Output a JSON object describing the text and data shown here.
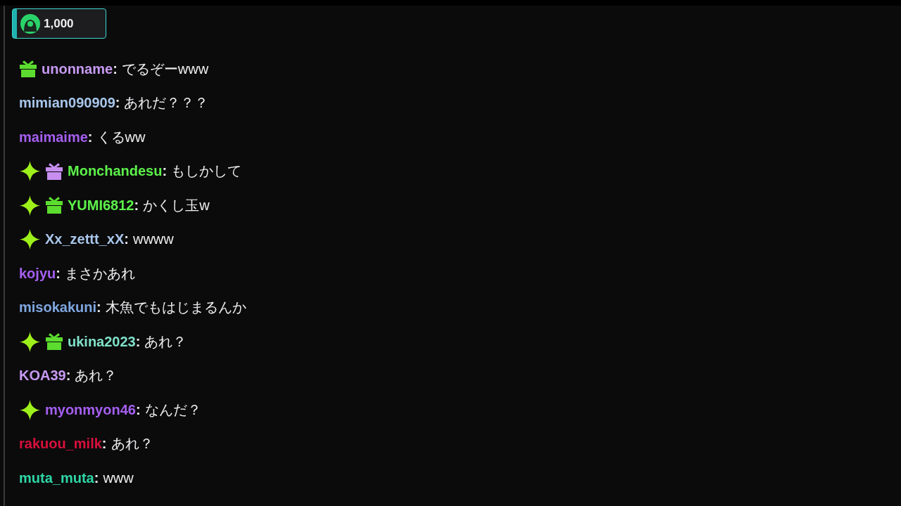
{
  "points_badge": {
    "count": "1,000"
  },
  "messages": [
    {
      "badges": [
        {
          "kind": "gift",
          "color": "#5bdc2e"
        }
      ],
      "user": "unonname",
      "color": "#c79af2",
      "colon": ":",
      "text": "でるぞーwww"
    },
    {
      "user": "mimian090909",
      "color": "#a9c6ea",
      "colon": ":",
      "text": "あれだ？？？"
    },
    {
      "user": "maimaime",
      "color": "#a55ff0",
      "colon": ":",
      "text": "くるww"
    },
    {
      "badges": [
        {
          "kind": "sparkle"
        },
        {
          "kind": "gift",
          "color": "#c78ef0"
        }
      ],
      "user": "Monchandesu",
      "color": "#5cf24a",
      "colon": ":",
      "text": "もしかして"
    },
    {
      "badges": [
        {
          "kind": "sparkle"
        },
        {
          "kind": "gift",
          "color": "#5bdc2e"
        }
      ],
      "user": "YUMI6812",
      "color": "#5cf24a",
      "colon": ":",
      "text": "かくし玉w"
    },
    {
      "badges": [
        {
          "kind": "sparkle"
        }
      ],
      "user": "Xx_zettt_xX",
      "color": "#a9c6ea",
      "colon": ":",
      "text": "wwww"
    },
    {
      "user": "kojyu",
      "color": "#a55ff0",
      "colon": ":",
      "text": "まさかあれ"
    },
    {
      "user": "misokakuni",
      "color": "#7fa7e0",
      "colon": ":",
      "text": "木魚でもはじまるんか"
    },
    {
      "badges": [
        {
          "kind": "sparkle"
        },
        {
          "kind": "gift",
          "color": "#5bdc2e"
        }
      ],
      "user": "ukina2023",
      "color": "#7fe0c8",
      "colon": ":",
      "text": "あれ？"
    },
    {
      "user": "KOA39",
      "color": "#c79af2",
      "colon": ":",
      "text": "あれ？"
    },
    {
      "badges": [
        {
          "kind": "sparkle"
        }
      ],
      "user": "myonmyon46",
      "color": "#a55ff0",
      "colon": ":",
      "text": "なんだ？"
    },
    {
      "user": "rakuou_milk",
      "color": "#d8103c",
      "colon": ":",
      "text": "あれ？"
    },
    {
      "user": "muta_muta",
      "color": "#2ed6a6",
      "colon": ":",
      "text": "www"
    }
  ]
}
